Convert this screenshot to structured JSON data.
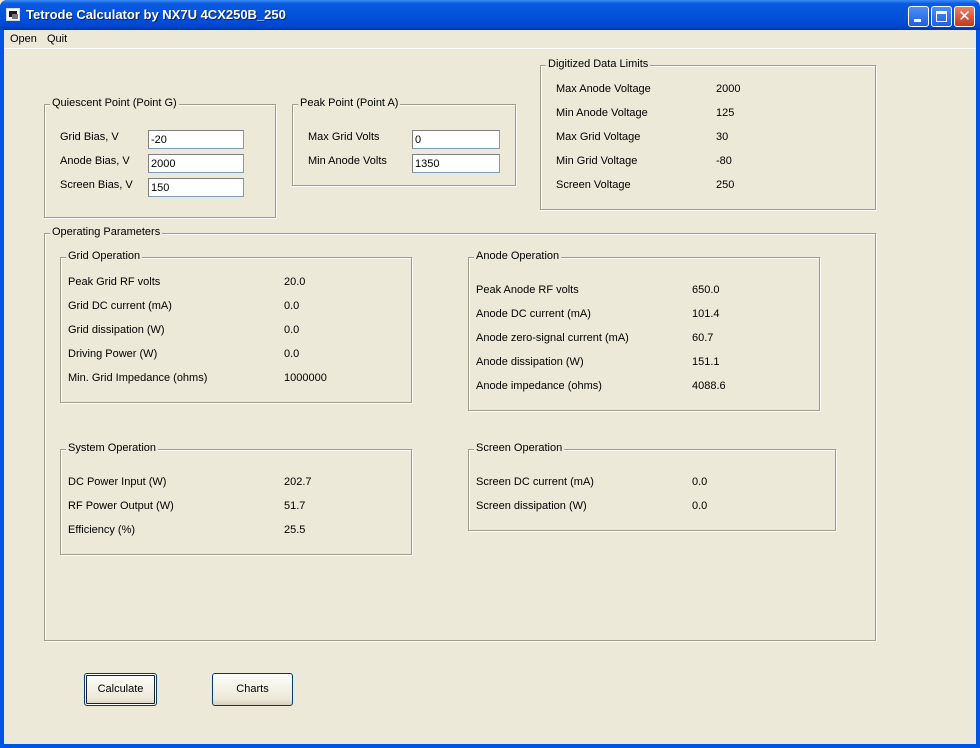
{
  "window": {
    "title": "Tetrode Calculator by NX7U 4CX250B_250"
  },
  "menu": {
    "open": "Open",
    "quit": "Quit"
  },
  "quiescent": {
    "title": "Quiescent Point (Point G)",
    "grid_bias_label": "Grid Bias, V",
    "grid_bias_value": "-20",
    "anode_bias_label": "Anode Bias, V",
    "anode_bias_value": "2000",
    "screen_bias_label": "Screen Bias, V",
    "screen_bias_value": "150"
  },
  "peak": {
    "title": "Peak Point (Point A)",
    "max_grid_label": "Max Grid Volts",
    "max_grid_value": "0",
    "min_anode_label": "Min Anode Volts",
    "min_anode_value": "1350"
  },
  "limits": {
    "title": "Digitized Data Limits",
    "rows": [
      {
        "label": "Max Anode Voltage",
        "value": "2000"
      },
      {
        "label": "Min Anode Voltage",
        "value": "125"
      },
      {
        "label": "Max Grid Voltage",
        "value": "30"
      },
      {
        "label": "Min Grid Voltage",
        "value": "-80"
      },
      {
        "label": "Screen Voltage",
        "value": "250"
      }
    ]
  },
  "operating": {
    "title": "Operating Parameters",
    "grid": {
      "title": "Grid Operation",
      "rows": [
        {
          "label": "Peak Grid RF volts",
          "value": "20.0"
        },
        {
          "label": "Grid DC current (mA)",
          "value": "0.0"
        },
        {
          "label": "Grid dissipation (W)",
          "value": "0.0"
        },
        {
          "label": "Driving Power (W)",
          "value": "0.0"
        },
        {
          "label": "Min. Grid Impedance (ohms)",
          "value": "1000000"
        }
      ]
    },
    "anode": {
      "title": "Anode Operation",
      "rows": [
        {
          "label": "Peak Anode RF volts",
          "value": "650.0"
        },
        {
          "label": "Anode DC current (mA)",
          "value": "101.4"
        },
        {
          "label": "Anode zero-signal current (mA)",
          "value": "60.7"
        },
        {
          "label": "Anode dissipation (W)",
          "value": "151.1"
        },
        {
          "label": "Anode impedance (ohms)",
          "value": "4088.6"
        }
      ]
    },
    "system": {
      "title": "System Operation",
      "rows": [
        {
          "label": "DC Power Input (W)",
          "value": "202.7"
        },
        {
          "label": "RF Power Output (W)",
          "value": "51.7"
        },
        {
          "label": "Efficiency (%)",
          "value": "25.5"
        }
      ]
    },
    "screen": {
      "title": "Screen Operation",
      "rows": [
        {
          "label": "Screen DC current (mA)",
          "value": "0.0"
        },
        {
          "label": "Screen dissipation (W)",
          "value": "0.0"
        }
      ]
    }
  },
  "buttons": {
    "calculate": "Calculate",
    "charts": "Charts"
  }
}
